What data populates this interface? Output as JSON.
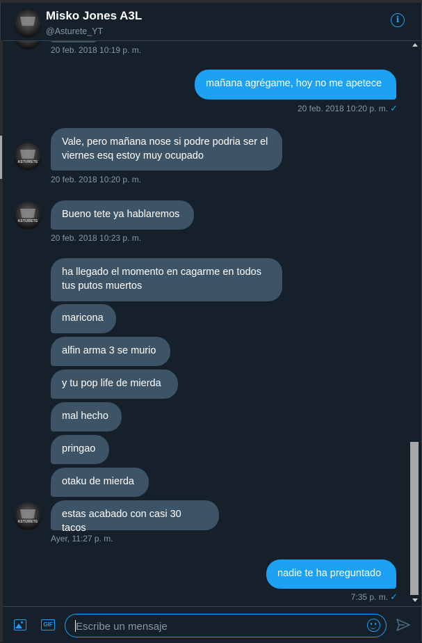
{
  "header": {
    "name": "Misko Jones A3L",
    "handle": "@Asturete_YT",
    "info_glyph": "i",
    "avatar_text": "ASTURETE"
  },
  "messages": [
    {
      "id": "m0",
      "direction": "in",
      "text": "",
      "timestamp": "20 feb. 2018 10:19 p. m."
    },
    {
      "id": "m1",
      "direction": "out",
      "text": "mañana agrégame, hoy no me apetece",
      "timestamp": "20 feb. 2018 10:20 p. m.",
      "read": true
    },
    {
      "id": "m2",
      "direction": "in",
      "text": "Vale, pero mañana nose si podre podria ser el viernes esq estoy muy ocupado",
      "timestamp": "20 feb. 2018 10:20 p. m."
    },
    {
      "id": "m3",
      "direction": "in",
      "text": "Bueno tete ya hablaremos",
      "timestamp": "20 feb. 2018 10:23 p. m."
    },
    {
      "id": "m4",
      "direction": "in",
      "text": "ha llegado el momento en cagarme en todos tus putos muertos"
    },
    {
      "id": "m5",
      "direction": "in",
      "text": "maricona"
    },
    {
      "id": "m6",
      "direction": "in",
      "text": "alfin arma 3 se murio"
    },
    {
      "id": "m7",
      "direction": "in",
      "text": "y tu pop life de mierda"
    },
    {
      "id": "m8",
      "direction": "in",
      "text": "mal hecho"
    },
    {
      "id": "m9",
      "direction": "in",
      "text": "pringao"
    },
    {
      "id": "m10",
      "direction": "in",
      "text": "otaku de mierda"
    },
    {
      "id": "m11",
      "direction": "in",
      "text": "estas acabado con casi 30 tacos",
      "timestamp": "Ayer, 11:27 p. m."
    },
    {
      "id": "m12",
      "direction": "out",
      "text": "nadie te ha preguntado",
      "timestamp": "7:35 p. m.",
      "read": true
    }
  ],
  "read_check": "✓",
  "composer": {
    "placeholder": "Escribe un mensaje",
    "gif_label": "GIF"
  },
  "icons": {
    "info": "info-icon",
    "media": "image-icon",
    "gif": "gif-icon",
    "emoji": "emoji-icon",
    "send": "send-icon"
  },
  "colors": {
    "background": "#15202b",
    "incoming_bubble": "#3d5466",
    "outgoing_bubble": "#1da1f2",
    "timestamp": "#8899a6",
    "accent": "#1da1f2"
  }
}
